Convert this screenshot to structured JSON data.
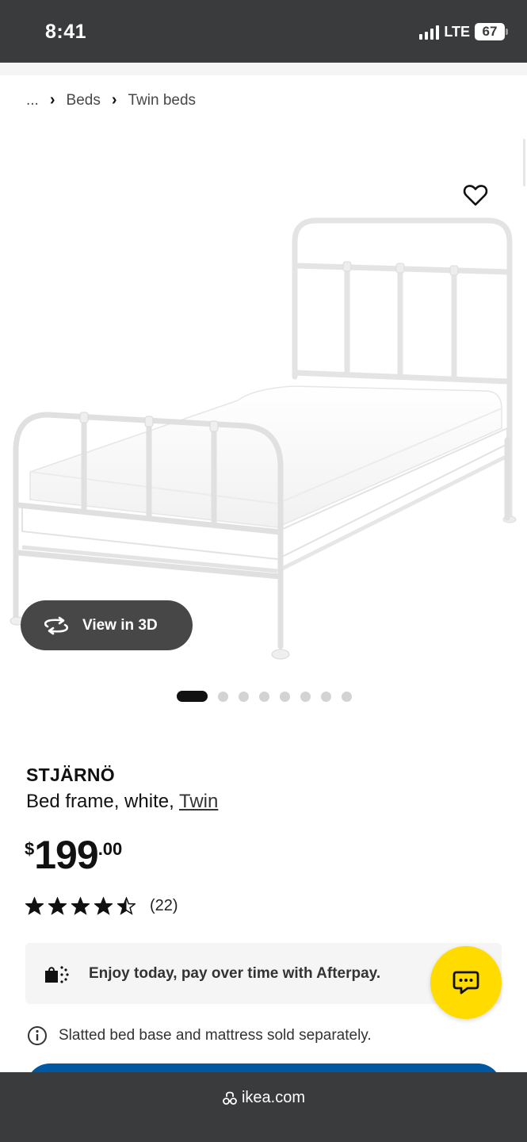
{
  "status_bar": {
    "time": "8:41",
    "network": "LTE",
    "battery": "67"
  },
  "breadcrumb": {
    "ellipsis": "...",
    "items": [
      "Beds",
      "Twin beds"
    ]
  },
  "gallery": {
    "view_3d_label": "View in 3D",
    "image_count": 8,
    "active_index": 0
  },
  "product": {
    "name": "STJÄRNÖ",
    "description": "Bed frame, white, ",
    "size_link": "Twin",
    "price": {
      "currency": "$",
      "integer": "199",
      "decimal": ".00"
    },
    "rating": 4.5,
    "rating_max": 5,
    "review_count": "(22)"
  },
  "afterpay": {
    "text": "Enjoy today, pay over time with Afterpay."
  },
  "note": {
    "text": "Slatted bed base and mattress sold separately."
  },
  "browser": {
    "url": "ikea.com"
  },
  "colors": {
    "status_bar": "#393b3c",
    "chat_fab": "#ffdb00",
    "cta": "#0058a3"
  }
}
